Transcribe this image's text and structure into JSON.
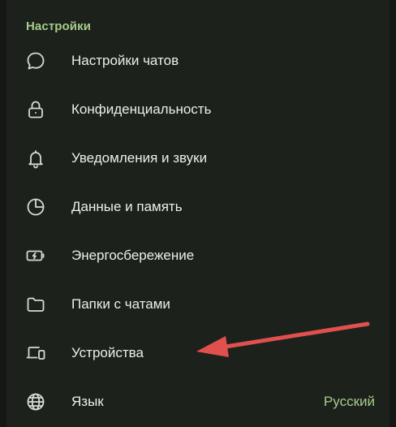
{
  "section": {
    "title": "Настройки"
  },
  "items": [
    {
      "label": "Настройки чатов",
      "icon": "chat-bubble-icon"
    },
    {
      "label": "Конфиденциальность",
      "icon": "lock-icon"
    },
    {
      "label": "Уведомления и звуки",
      "icon": "bell-icon"
    },
    {
      "label": "Данные и память",
      "icon": "pie-chart-icon"
    },
    {
      "label": "Энергосбережение",
      "icon": "battery-icon"
    },
    {
      "label": "Папки с чатами",
      "icon": "folder-icon"
    },
    {
      "label": "Устройства",
      "icon": "devices-icon"
    },
    {
      "label": "Язык",
      "icon": "globe-icon",
      "value": "Русский"
    }
  ],
  "colors": {
    "accent": "#a5cd8c",
    "background": "#1d211c",
    "text": "#eceee9",
    "annotation_arrow": "#e0504f"
  }
}
